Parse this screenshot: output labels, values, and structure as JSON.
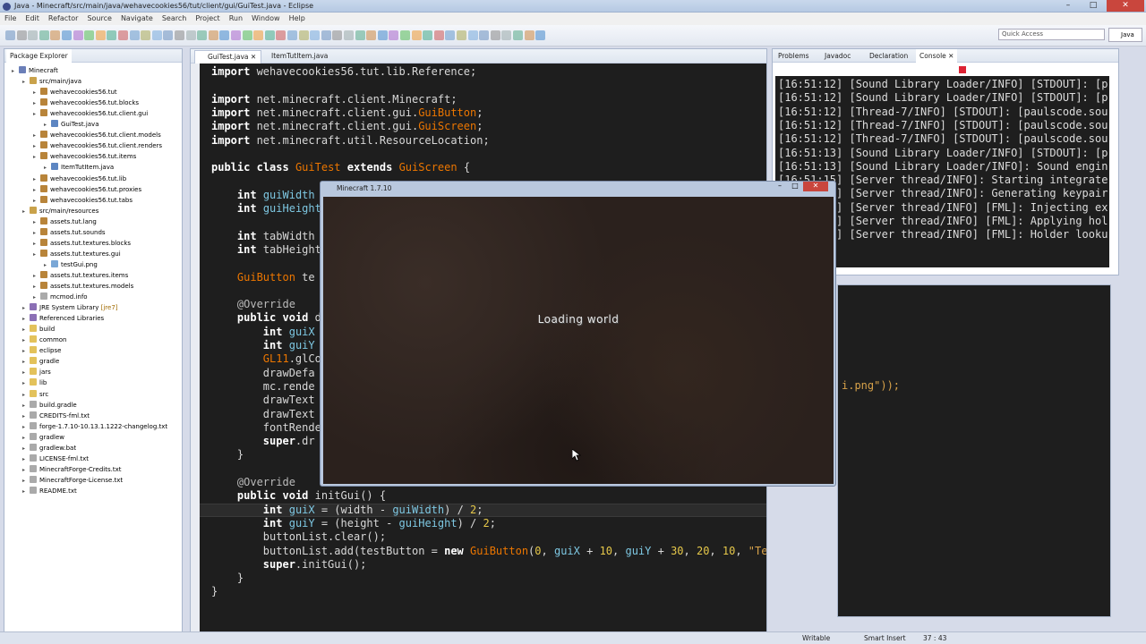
{
  "window": {
    "title": "Java - Minecraft/src/main/java/wehavecookies56/tut/client/gui/GuiTest.java - Eclipse"
  },
  "menu": [
    "File",
    "Edit",
    "Refactor",
    "Source",
    "Navigate",
    "Search",
    "Project",
    "Run",
    "Window",
    "Help"
  ],
  "toolbar": {
    "quick_access": "Quick Access",
    "perspective": "Java"
  },
  "package_explorer": {
    "tab": "Package Explorer",
    "items": [
      {
        "label": "Minecraft",
        "indent": 0,
        "icon": "project-icon"
      },
      {
        "label": "src/main/java",
        "indent": 1,
        "icon": "source-folder-icon"
      },
      {
        "label": "wehavecookies56.tut",
        "indent": 2,
        "icon": "package-icon"
      },
      {
        "label": "wehavecookies56.tut.blocks",
        "indent": 2,
        "icon": "package-icon"
      },
      {
        "label": "wehavecookies56.tut.client.gui",
        "indent": 2,
        "icon": "package-icon"
      },
      {
        "label": "GuiTest.java",
        "indent": 3,
        "icon": "java-file-icon"
      },
      {
        "label": "wehavecookies56.tut.client.models",
        "indent": 2,
        "icon": "package-icon"
      },
      {
        "label": "wehavecookies56.tut.client.renders",
        "indent": 2,
        "icon": "package-icon"
      },
      {
        "label": "wehavecookies56.tut.items",
        "indent": 2,
        "icon": "package-icon"
      },
      {
        "label": "ItemTutItem.java",
        "indent": 3,
        "icon": "java-file-icon"
      },
      {
        "label": "wehavecookies56.tut.lib",
        "indent": 2,
        "icon": "package-icon"
      },
      {
        "label": "wehavecookies56.tut.proxies",
        "indent": 2,
        "icon": "package-icon"
      },
      {
        "label": "wehavecookies56.tut.tabs",
        "indent": 2,
        "icon": "package-icon"
      },
      {
        "label": "src/main/resources",
        "indent": 1,
        "icon": "source-folder-icon"
      },
      {
        "label": "assets.tut.lang",
        "indent": 2,
        "icon": "package-icon"
      },
      {
        "label": "assets.tut.sounds",
        "indent": 2,
        "icon": "package-icon"
      },
      {
        "label": "assets.tut.textures.blocks",
        "indent": 2,
        "icon": "package-icon"
      },
      {
        "label": "assets.tut.textures.gui",
        "indent": 2,
        "icon": "package-icon"
      },
      {
        "label": "testGui.png",
        "indent": 3,
        "icon": "image-file-icon"
      },
      {
        "label": "assets.tut.textures.items",
        "indent": 2,
        "icon": "package-icon"
      },
      {
        "label": "assets.tut.textures.models",
        "indent": 2,
        "icon": "package-icon"
      },
      {
        "label": "mcmod.info",
        "indent": 2,
        "icon": "file-icon"
      },
      {
        "label": "JRE System Library",
        "deco": "[jre7]",
        "indent": 1,
        "icon": "library-icon"
      },
      {
        "label": "Referenced Libraries",
        "indent": 1,
        "icon": "library-icon"
      },
      {
        "label": "build",
        "indent": 1,
        "icon": "folder-icon"
      },
      {
        "label": "common",
        "indent": 1,
        "icon": "folder-icon"
      },
      {
        "label": "eclipse",
        "indent": 1,
        "icon": "folder-icon"
      },
      {
        "label": "gradle",
        "indent": 1,
        "icon": "folder-icon"
      },
      {
        "label": "jars",
        "indent": 1,
        "icon": "folder-icon"
      },
      {
        "label": "lib",
        "indent": 1,
        "icon": "folder-icon"
      },
      {
        "label": "src",
        "indent": 1,
        "icon": "folder-icon"
      },
      {
        "label": "build.gradle",
        "indent": 1,
        "icon": "file-icon"
      },
      {
        "label": "CREDITS-fml.txt",
        "indent": 1,
        "icon": "file-icon"
      },
      {
        "label": "forge-1.7.10-10.13.1.1222-changelog.txt",
        "indent": 1,
        "icon": "file-icon"
      },
      {
        "label": "gradlew",
        "indent": 1,
        "icon": "file-icon"
      },
      {
        "label": "gradlew.bat",
        "indent": 1,
        "icon": "file-icon"
      },
      {
        "label": "LICENSE-fml.txt",
        "indent": 1,
        "icon": "file-icon"
      },
      {
        "label": "MinecraftForge-Credits.txt",
        "indent": 1,
        "icon": "file-icon"
      },
      {
        "label": "MinecraftForge-License.txt",
        "indent": 1,
        "icon": "file-icon"
      },
      {
        "label": "README.txt",
        "indent": 1,
        "icon": "file-icon"
      }
    ]
  },
  "editor": {
    "tabs": [
      "GuiTest.java",
      "ItemTutItem.java"
    ],
    "code": [
      "import wehavecookies56.tut.lib.Reference;",
      "",
      "import net.minecraft.client.Minecraft;",
      "import net.minecraft.client.gui.GuiButton;",
      "import net.minecraft.client.gui.GuiScreen;",
      "import net.minecraft.util.ResourceLocation;",
      "",
      "public class GuiTest extends GuiScreen {",
      "",
      "    int guiWidth",
      "    int guiHeight",
      "",
      "    int tabWidth",
      "    int tabHeight",
      "",
      "    GuiButton te",
      "",
      "    @Override",
      "    public void d",
      "        int guiX",
      "        int guiY",
      "        GL11.glCo",
      "        drawDefa",
      "        mc.rende",
      "        drawText",
      "        drawText",
      "        fontRende",
      "        super.dr",
      "    }",
      "",
      "    @Override",
      "    public void initGui() {",
      "        int guiX = (width - guiWidth) / 2;",
      "        int guiY = (height - guiHeight) / 2;",
      "        buttonList.clear();",
      "        buttonList.add(testButton = new GuiButton(0, guiX + 10, guiY + 30, 20, 10, \"Test\"));",
      "        super.initGui();",
      "    }",
      "}"
    ],
    "fragment_png": "i.png\"));"
  },
  "right_panel": {
    "tabs": [
      "Problems",
      "Javadoc",
      "Declaration",
      "Console"
    ],
    "console": [
      "[16:51:12] [Sound Library Loader/INFO] [STDOUT]: [p",
      "[16:51:12] [Sound Library Loader/INFO] [STDOUT]: [p",
      "[16:51:12] [Thread-7/INFO] [STDOUT]: [paulscode.sou",
      "[16:51:12] [Thread-7/INFO] [STDOUT]: [paulscode.sou",
      "[16:51:12] [Thread-7/INFO] [STDOUT]: [paulscode.sou",
      "[16:51:13] [Sound Library Loader/INFO] [STDOUT]: [p",
      "[16:51:13] [Sound Library Loader/INFO]: Sound engin",
      "[16:51:15] [Server thread/INFO]: Starting integrate",
      "[16:51:15] [Server thread/INFO]: Generating keypair",
      "[16:51:15] [Server thread/INFO] [FML]: Injecting ex",
      "[16:51:15] [Server thread/INFO] [FML]: Applying hol",
      "[16:51:15] [Server thread/INFO] [FML]: Holder looku"
    ]
  },
  "minecraft": {
    "title": "Minecraft 1.7.10",
    "message": "Loading world"
  },
  "status": {
    "writable": "Writable",
    "insert": "Smart Insert",
    "position": "37 : 43"
  }
}
